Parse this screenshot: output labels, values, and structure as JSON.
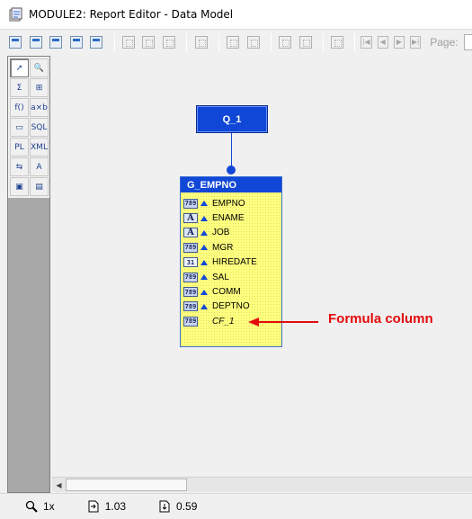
{
  "window": {
    "title": "MODULE2: Report Editor - Data Model"
  },
  "toolbar": {
    "page_label": "Page:",
    "icons": [
      "report-icon",
      "open-icon",
      "properties-icon",
      "preview-icon",
      "layout-icon",
      "bring-front-icon",
      "send-back-icon",
      "move-forward-icon",
      "move-backward-icon",
      "group-icon",
      "ungroup-icon",
      "align-icon",
      "select-parent-icon",
      "select-children-icon",
      "select-all-icon",
      "first-page-icon",
      "previous-page-icon",
      "next-page-icon",
      "last-page-icon"
    ]
  },
  "palette": {
    "tools": [
      {
        "name": "select-tool",
        "glyph": "➚",
        "active": true
      },
      {
        "name": "magnify-tool",
        "glyph": "🔍"
      },
      {
        "name": "summary-column-tool",
        "glyph": "Σ"
      },
      {
        "name": "data-link-tool",
        "glyph": "⊞"
      },
      {
        "name": "formula-column-tool",
        "glyph": "f()"
      },
      {
        "name": "placeholder-column-tool",
        "glyph": "a×b"
      },
      {
        "name": "cross-product-tool",
        "glyph": "▭"
      },
      {
        "name": "sql-query-tool",
        "glyph": "SQL"
      },
      {
        "name": "plsql-query-tool",
        "glyph": "PL"
      },
      {
        "name": "xml-query-tool",
        "glyph": "XML"
      },
      {
        "name": "ref-cursor-tool",
        "glyph": "⇆"
      },
      {
        "name": "text-query-tool",
        "glyph": "A"
      },
      {
        "name": "express-query-tool",
        "glyph": "▣"
      },
      {
        "name": "ole-query-tool",
        "glyph": "▤"
      }
    ]
  },
  "model": {
    "query": {
      "name": "Q_1"
    },
    "group": {
      "name": "G_EMPNO",
      "columns": [
        {
          "label": "EMPNO",
          "type_glyph": "789",
          "kind": "number",
          "linked": true
        },
        {
          "label": "ENAME",
          "type_glyph": "A",
          "kind": "char",
          "linked": true
        },
        {
          "label": "JOB",
          "type_glyph": "A",
          "kind": "char",
          "linked": true
        },
        {
          "label": "MGR",
          "type_glyph": "789",
          "kind": "number",
          "linked": true
        },
        {
          "label": "HIREDATE",
          "type_glyph": "31",
          "kind": "date",
          "linked": true
        },
        {
          "label": "SAL",
          "type_glyph": "789",
          "kind": "number",
          "linked": true
        },
        {
          "label": "COMM",
          "type_glyph": "789",
          "kind": "number",
          "linked": true
        },
        {
          "label": "DEPTNO",
          "type_glyph": "789",
          "kind": "number",
          "linked": true
        },
        {
          "label": "CF_1",
          "type_glyph": "789",
          "kind": "number",
          "linked": false
        }
      ]
    }
  },
  "annotation": {
    "text": "Formula column",
    "color": "#e20b0b"
  },
  "status": {
    "zoom": "1x",
    "horizontal_position": "1.03",
    "vertical_position": "0.59"
  },
  "colors": {
    "accent": "#1047d6",
    "group_fill": "#ffff80"
  }
}
